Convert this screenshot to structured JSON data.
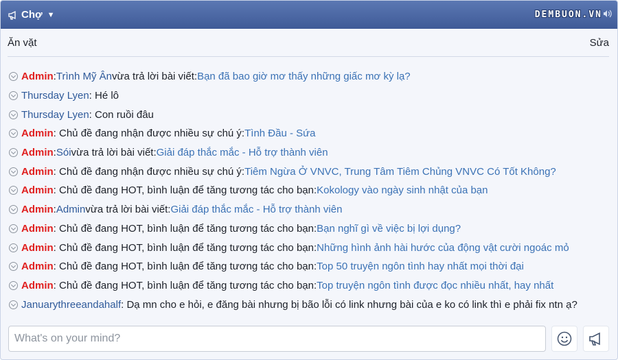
{
  "header": {
    "title": "Chợ",
    "brand": "DEMBUON.VN",
    "icons": {
      "left": "megaphone-icon",
      "caret": "caret-down-icon",
      "right": "speaker-icon"
    }
  },
  "subbar": {
    "left_label": "Ăn vặt",
    "right_label": "Sửa"
  },
  "messages": [
    {
      "user": "Admin",
      "role": "admin",
      "text": ": ",
      "actor": "Trình Mỹ Ân",
      "text2": " vừa trả lời bài viết: ",
      "link": "Bạn đã bao giờ mơ thấy những giấc mơ kỳ lạ?"
    },
    {
      "user": "Thursday Lyen",
      "role": "user",
      "text": ": Hé lô",
      "actor": "",
      "text2": "",
      "link": ""
    },
    {
      "user": "Thursday Lyen",
      "role": "user",
      "text": ": Con ruồi đâu",
      "actor": "",
      "text2": "",
      "link": ""
    },
    {
      "user": "Admin",
      "role": "admin",
      "text": ": Chủ đề đang nhận được nhiều sự chú ý: ",
      "actor": "",
      "text2": "",
      "link": "Tình Đầu - Sứa"
    },
    {
      "user": "Admin",
      "role": "admin",
      "text": ": ",
      "actor": "Sói",
      "text2": " vừa trả lời bài viết: ",
      "link": "Giải đáp thắc mắc - Hỗ trợ thành viên"
    },
    {
      "user": "Admin",
      "role": "admin",
      "text": ": Chủ đề đang nhận được nhiều sự chú ý: ",
      "actor": "",
      "text2": "",
      "link": "Tiêm Ngừa Ở VNVC, Trung Tâm Tiêm Chủng VNVC Có Tốt Không?"
    },
    {
      "user": "Admin",
      "role": "admin",
      "text": ": Chủ đề đang HOT, bình luận để tăng tương tác cho bạn: ",
      "actor": "",
      "text2": "",
      "link": "Kokology vào ngày sinh nhật của bạn"
    },
    {
      "user": "Admin",
      "role": "admin",
      "text": ": ",
      "actor": "Admin",
      "text2": " vừa trả lời bài viết: ",
      "link": "Giải đáp thắc mắc - Hỗ trợ thành viên"
    },
    {
      "user": "Admin",
      "role": "admin",
      "text": ": Chủ đề đang HOT, bình luận để tăng tương tác cho bạn: ",
      "actor": "",
      "text2": "",
      "link": "Bạn nghĩ gì về việc bị lợi dụng?"
    },
    {
      "user": "Admin",
      "role": "admin",
      "text": ": Chủ đề đang HOT, bình luận để tăng tương tác cho bạn: ",
      "actor": "",
      "text2": "",
      "link": "Những hình ảnh hài hước của động vật cười ngoác mỏ"
    },
    {
      "user": "Admin",
      "role": "admin",
      "text": ": Chủ đề đang HOT, bình luận để tăng tương tác cho bạn: ",
      "actor": "",
      "text2": "",
      "link": "Top 50 truyện ngôn tình hay nhất mọi thời đại"
    },
    {
      "user": "Admin",
      "role": "admin",
      "text": ": Chủ đề đang HOT, bình luận để tăng tương tác cho bạn: ",
      "actor": "",
      "text2": "",
      "link": "Top truyện ngôn tình được đọc nhiều nhất, hay nhất"
    },
    {
      "user": "Januarythreeandahalf",
      "role": "user",
      "text": ": Dạ mn cho e hỏi, e đăng bài nhưng bị bão lỗi có link nhưng bài của e ko có link thì e phải fix ntn ạ?",
      "actor": "",
      "text2": "",
      "link": ""
    }
  ],
  "input": {
    "placeholder": "What's on your mind?",
    "value": ""
  },
  "buttons": {
    "emoji": "smiley-icon",
    "send": "megaphone-icon"
  },
  "colors": {
    "header": "#4a66a3",
    "admin": "#e02020",
    "link": "#3b72b5"
  }
}
